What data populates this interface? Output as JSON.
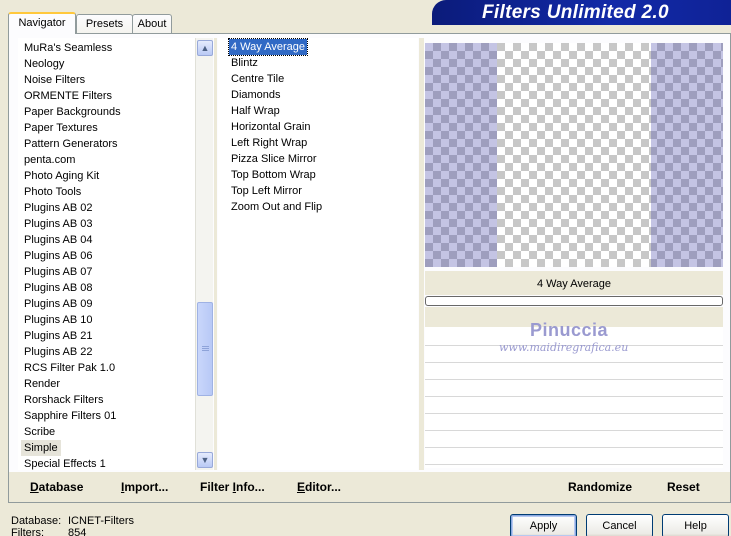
{
  "tabs": [
    "Navigator",
    "Presets",
    "About"
  ],
  "banner_title": "Filters Unlimited 2.0",
  "categories": [
    "MuRa's Seamless",
    "Neology",
    "Noise Filters",
    "ORMENTE Filters",
    "Paper Backgrounds",
    "Paper Textures",
    "Pattern Generators",
    "penta.com",
    "Photo Aging Kit",
    "Photo Tools",
    "Plugins AB 02",
    "Plugins AB 03",
    "Plugins AB 04",
    "Plugins AB 06",
    "Plugins AB 07",
    "Plugins AB 08",
    "Plugins AB 09",
    "Plugins AB 10",
    "Plugins AB 21",
    "Plugins AB 22",
    "RCS Filter Pak 1.0",
    "Render",
    "Rorshack Filters",
    "Sapphire Filters 01",
    "Scribe",
    "Simple",
    "Special Effects 1"
  ],
  "selected_category": "Simple",
  "filters": [
    "4 Way Average",
    "Blintz",
    "Centre Tile",
    "Diamonds",
    "Half Wrap",
    "Horizontal Grain",
    "Left Right Wrap",
    "Pizza Slice Mirror",
    "Top Bottom Wrap",
    "Top Left Mirror",
    "Zoom Out and Flip"
  ],
  "selected_filter": "4 Way Average",
  "preview_filter_name": "4 Way Average",
  "watermark": {
    "name": "Pinuccia",
    "url": "www.maidiregrafica.eu"
  },
  "actions": {
    "database": {
      "u": "D",
      "rest": "atabase"
    },
    "import": {
      "u": "I",
      "rest": "mport..."
    },
    "filter_info": {
      "pre": "Filter ",
      "u": "I",
      "rest": "nfo..."
    },
    "editor": {
      "u": "E",
      "rest": "ditor..."
    },
    "randomize": "Randomize",
    "reset": "Reset"
  },
  "status": {
    "database_label": "Database:",
    "database_value": "ICNET-Filters",
    "filters_label": "Filters:",
    "filters_value": "854"
  },
  "buttons": {
    "apply": "Apply",
    "cancel": "Cancel",
    "help": "Help"
  },
  "colors": {
    "selection": "#316ac5",
    "banner": "#0f2296",
    "preview_band": "#8c8cc8"
  }
}
